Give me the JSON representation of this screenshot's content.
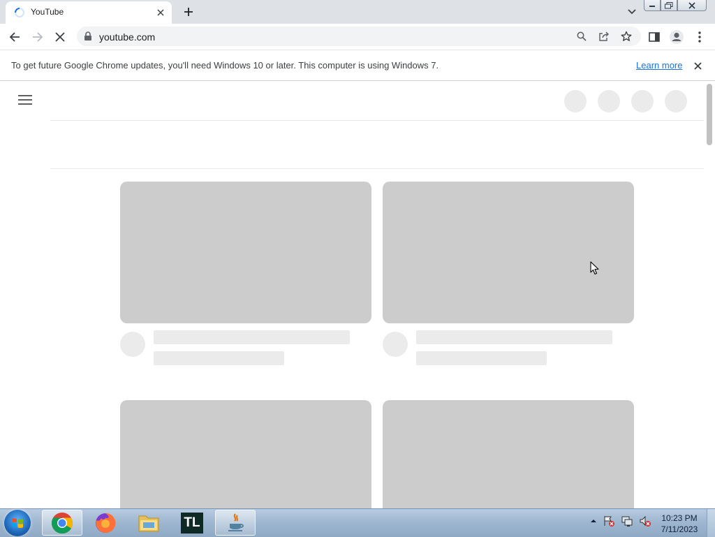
{
  "browser": {
    "tab": {
      "title": "YouTube"
    },
    "address": {
      "url": "youtube.com"
    }
  },
  "infobar": {
    "message": "To get future Google Chrome updates, you'll need Windows 10 or later. This computer is using Windows 7.",
    "link": "Learn more"
  },
  "page": {
    "loading": true
  },
  "taskbar": {
    "apps": [
      {
        "name": "Google Chrome",
        "active": true
      },
      {
        "name": "Firefox",
        "active": false
      },
      {
        "name": "File Explorer",
        "active": false
      },
      {
        "name": "TL",
        "active": false
      },
      {
        "name": "Java",
        "active": true
      }
    ],
    "tl_label": "TL",
    "time": "10:23 PM",
    "date": "7/11/2023"
  },
  "colors": {
    "tabstrip": "#dee1e6",
    "skeleton_thumb": "#cccccc",
    "skeleton_light": "#ebebeb",
    "link": "#1a73e8"
  }
}
